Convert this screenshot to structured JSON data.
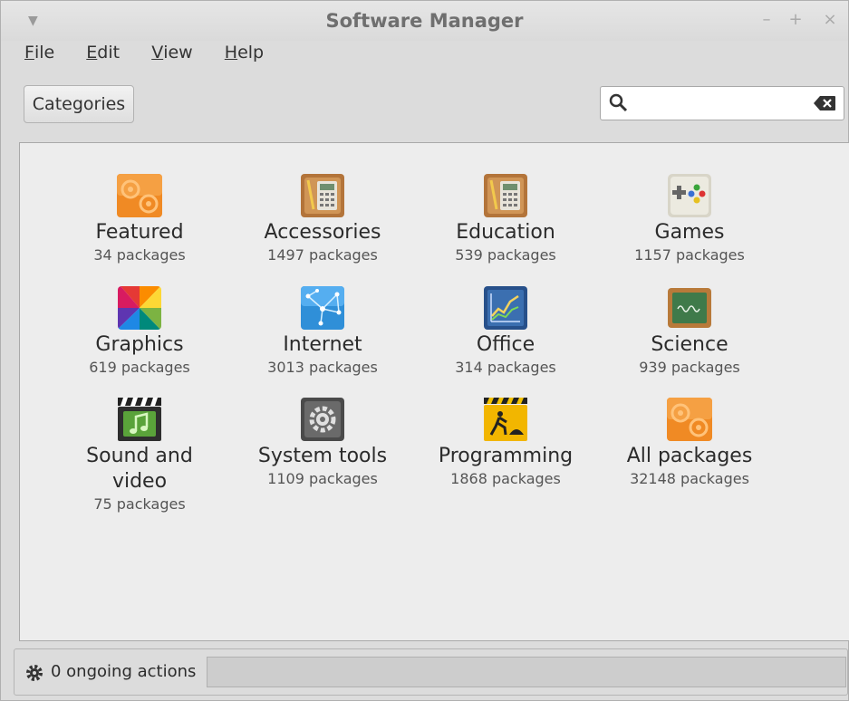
{
  "window": {
    "title": "Software Manager"
  },
  "menubar": {
    "items": [
      {
        "key": "F",
        "rest": "ile"
      },
      {
        "key": "E",
        "rest": "dit"
      },
      {
        "key": "V",
        "rest": "iew"
      },
      {
        "key": "H",
        "rest": "elp"
      }
    ]
  },
  "toolbar": {
    "categories_label": "Categories"
  },
  "search": {
    "placeholder": "",
    "value": ""
  },
  "categories": [
    {
      "name": "Featured",
      "count": "34 packages",
      "icon": "featured-icon"
    },
    {
      "name": "Accessories",
      "count": "1497 packages",
      "icon": "calculator-icon"
    },
    {
      "name": "Education",
      "count": "539 packages",
      "icon": "calculator-icon"
    },
    {
      "name": "Games",
      "count": "1157 packages",
      "icon": "gamepad-icon"
    },
    {
      "name": "Graphics",
      "count": "619 packages",
      "icon": "color-wheel-icon"
    },
    {
      "name": "Internet",
      "count": "3013 packages",
      "icon": "network-icon"
    },
    {
      "name": "Office",
      "count": "314 packages",
      "icon": "chart-icon"
    },
    {
      "name": "Science",
      "count": "939 packages",
      "icon": "chalkboard-icon"
    },
    {
      "name": "Sound and video",
      "count": "75 packages",
      "icon": "clapperboard-icon"
    },
    {
      "name": "System tools",
      "count": "1109 packages",
      "icon": "system-gear-icon"
    },
    {
      "name": "Programming",
      "count": "1868 packages",
      "icon": "construction-icon"
    },
    {
      "name": "All packages",
      "count": "32148 packages",
      "icon": "featured-icon"
    }
  ],
  "status": {
    "text": "0 ongoing actions",
    "progress": 0
  },
  "colors": {
    "accent": "#8ab4e6"
  }
}
